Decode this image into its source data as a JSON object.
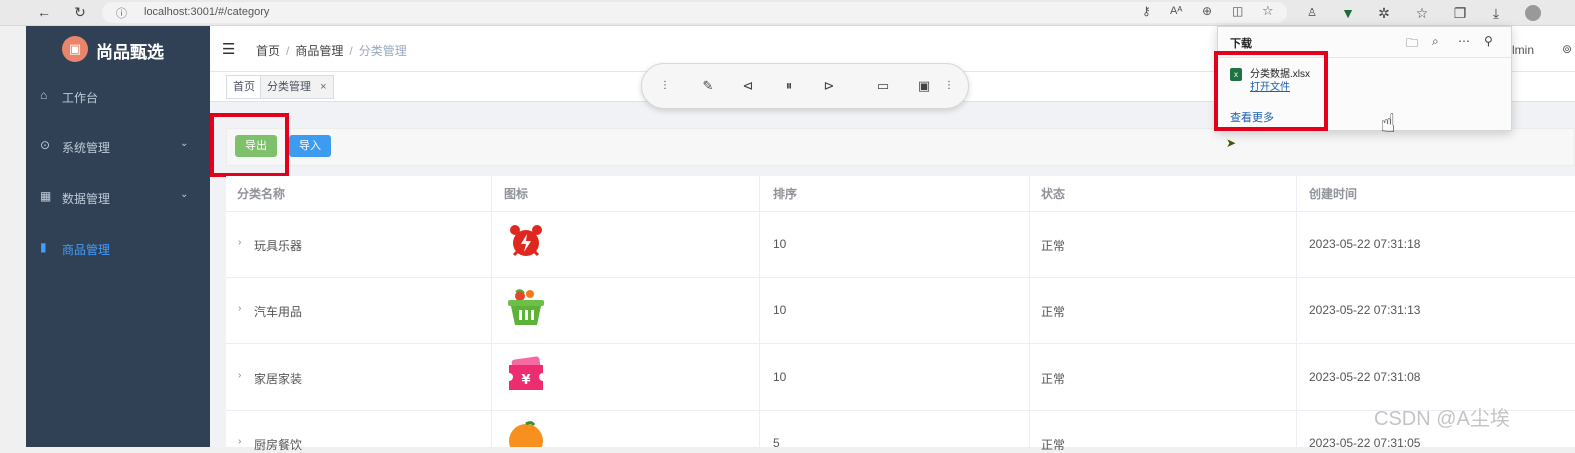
{
  "browser": {
    "url": "localhost:3001/#/category"
  },
  "sidebar": {
    "logo_text": "尚品甄选",
    "items": [
      {
        "label": "工作台",
        "icon": "home-icon"
      },
      {
        "label": "系统管理",
        "icon": "location-icon"
      },
      {
        "label": "数据管理",
        "icon": "grid-icon"
      },
      {
        "label": "商品管理",
        "icon": "bar-chart-icon",
        "active": true
      }
    ]
  },
  "navbar": {
    "breadcrumb": [
      "首页",
      "商品管理",
      "分类管理"
    ],
    "user_partial": "lmin"
  },
  "tags": [
    {
      "label": "首页"
    },
    {
      "label": "分类管理",
      "close": "×"
    }
  ],
  "toolbar": {
    "export_label": "导出",
    "import_label": "导入"
  },
  "table": {
    "columns": [
      "分类名称",
      "图标",
      "排序",
      "状态",
      "创建时间"
    ],
    "rows": [
      {
        "name": "玩具乐器",
        "icon": "alarm-clock-icon",
        "sort": "10",
        "status": "正常",
        "created": "2023-05-22 07:31:18"
      },
      {
        "name": "汽车用品",
        "icon": "basket-icon",
        "sort": "10",
        "status": "正常",
        "created": "2023-05-22 07:31:13"
      },
      {
        "name": "家居家装",
        "icon": "ticket-icon",
        "sort": "10",
        "status": "正常",
        "created": "2023-05-22 07:31:08"
      },
      {
        "name": "厨房餐饮",
        "icon": "orange-icon",
        "sort": "5",
        "status": "正常",
        "created": "2023-05-22 07:31:05"
      }
    ]
  },
  "download": {
    "title": "下载",
    "file_name": "分类数据.xlsx",
    "open_file": "打开文件",
    "see_more": "查看更多"
  },
  "watermark": "CSDN @A尘埃",
  "colors": {
    "sidebar_bg": "#304156",
    "export_btn": "#7ec06b",
    "import_btn": "#3d9cf0",
    "highlight": "#e3001b",
    "active_menu": "#409eff"
  }
}
